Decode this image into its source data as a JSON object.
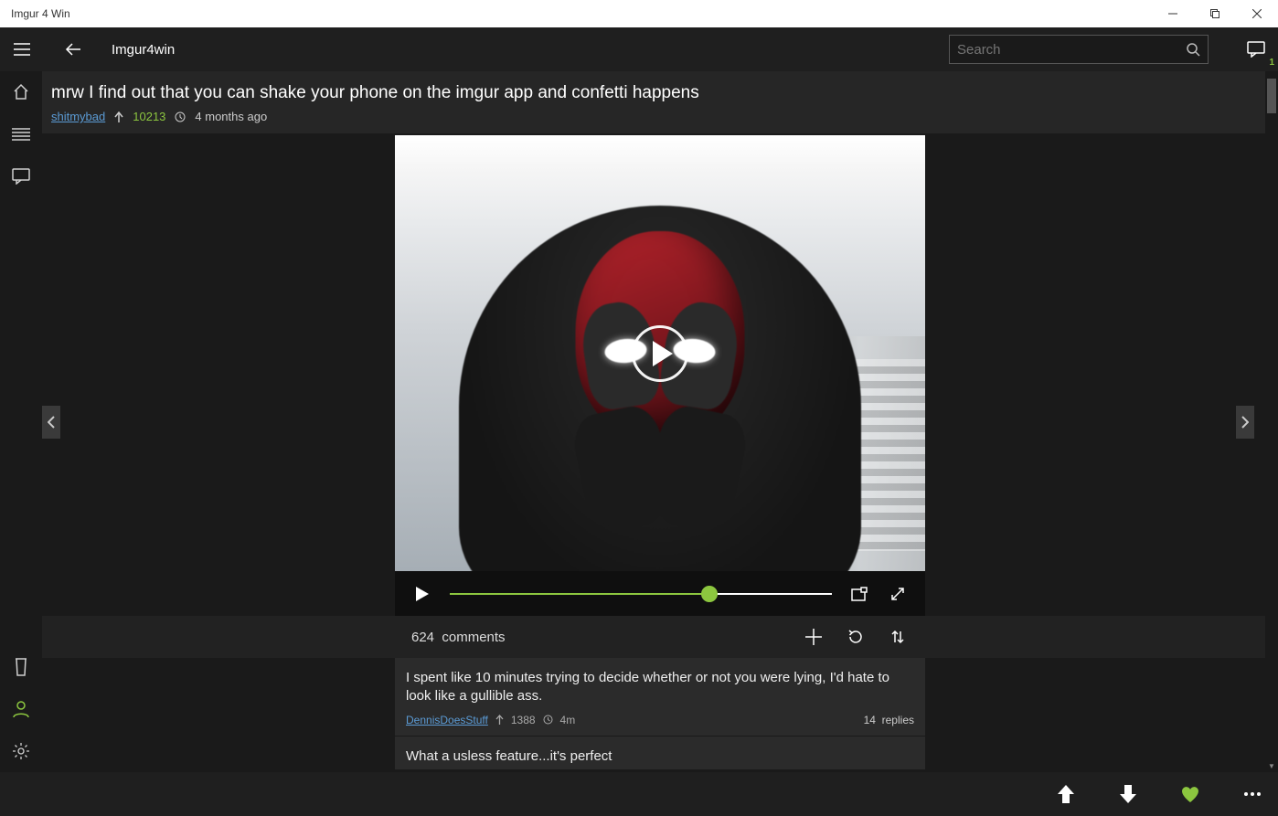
{
  "window": {
    "title": "Imgur 4 Win"
  },
  "app": {
    "name": "Imgur4win",
    "search_placeholder": "Search",
    "messages_badge": "1"
  },
  "post": {
    "title": "mrw I find out that you can shake your phone on the imgur app and confetti happens",
    "author": "shitmybad",
    "points": "10213",
    "age": "4 months ago"
  },
  "video": {
    "progress_percent": 68
  },
  "comments": {
    "count": "624",
    "label": "comments",
    "items": [
      {
        "text": "I spent like 10 minutes trying to decide whether or not you were lying, I'd hate to look like a gullible ass.",
        "author": "DennisDoesStuff",
        "points": "1388",
        "age": "4m",
        "replies_count": "14",
        "replies_label": "replies"
      },
      {
        "text": "What a usless feature...it's perfect"
      }
    ]
  },
  "colors": {
    "accent": "#8cc63f",
    "link": "#5b9bd5"
  }
}
